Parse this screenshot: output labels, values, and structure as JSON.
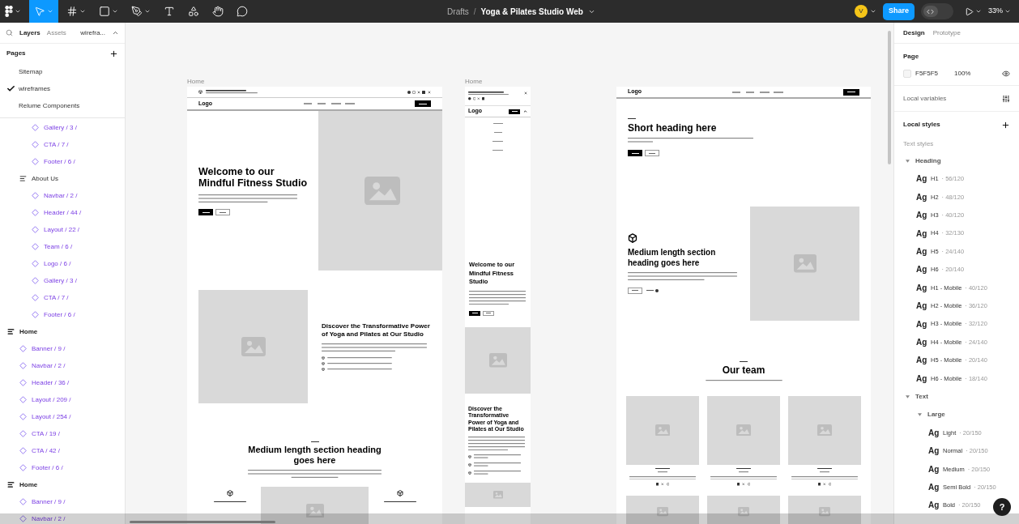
{
  "toolbar": {
    "tools": [
      {
        "kind": "figma",
        "selected": false,
        "menu": true
      },
      {
        "kind": "move",
        "selected": true,
        "menu": true
      },
      {
        "kind": "frame",
        "selected": false,
        "menu": true
      },
      {
        "kind": "shape",
        "selected": false,
        "menu": true
      },
      {
        "kind": "pen",
        "selected": false,
        "menu": true
      },
      {
        "kind": "text",
        "selected": false,
        "menu": false
      },
      {
        "kind": "resources",
        "selected": false,
        "menu": false
      },
      {
        "kind": "hand",
        "selected": false,
        "menu": false
      },
      {
        "kind": "comment",
        "selected": false,
        "menu": false
      }
    ],
    "breadcrumb": {
      "folder": "Drafts",
      "separator": "/",
      "file": "Yoga & Pilates Studio Web"
    },
    "avatar": "V",
    "share": "Share",
    "dev_mode": false,
    "zoom": "33%"
  },
  "left_panel": {
    "tabs": [
      {
        "label": "Layers",
        "selected": true
      },
      {
        "label": "Assets",
        "selected": false
      }
    ],
    "page_switcher": "wirefra...",
    "pages_title": "Pages",
    "pages": [
      {
        "name": "Sitemap",
        "selected": false
      },
      {
        "name": "wireframes",
        "selected": true
      },
      {
        "name": "Relume Components",
        "selected": false
      }
    ],
    "layers": [
      {
        "children": [
          {
            "children": [
              {
                "name": "Gallery / 3 /",
                "kind": "component"
              },
              {
                "name": "CTA / 7 /",
                "kind": "component"
              },
              {
                "name": "Footer / 6 /",
                "kind": "component"
              }
            ]
          },
          {
            "name": "About Us",
            "kind": "frame",
            "children": [
              {
                "name": "Navbar / 2 /",
                "kind": "component"
              },
              {
                "name": "Header / 44 /",
                "kind": "component"
              },
              {
                "name": "Layout / 22 /",
                "kind": "component"
              },
              {
                "name": "Team / 6 /",
                "kind": "component"
              },
              {
                "name": "Logo / 6 /",
                "kind": "component"
              },
              {
                "name": "Gallery / 3 /",
                "kind": "component"
              },
              {
                "name": "CTA / 7 /",
                "kind": "component"
              },
              {
                "name": "Footer / 6 /",
                "kind": "component"
              }
            ]
          }
        ]
      },
      {
        "name": "Home",
        "kind": "frame",
        "children": [
          {
            "name": "Banner / 9 /",
            "kind": "component"
          },
          {
            "name": "Navbar / 2 /",
            "kind": "component"
          },
          {
            "name": "Header / 36 /",
            "kind": "component"
          },
          {
            "name": "Layout / 209 /",
            "kind": "component"
          },
          {
            "name": "Layout / 254 /",
            "kind": "component"
          },
          {
            "name": "CTA / 19 /",
            "kind": "component"
          },
          {
            "name": "CTA / 42 /",
            "kind": "component"
          },
          {
            "name": "Footer / 6 /",
            "kind": "component"
          }
        ]
      },
      {
        "name": "Home",
        "kind": "frame",
        "children": [
          {
            "name": "Banner / 9 /",
            "kind": "component"
          },
          {
            "name": "Navbar / 2 /",
            "kind": "component"
          }
        ]
      }
    ]
  },
  "canvas": {
    "frames": [
      {
        "kind": "desktop-home",
        "label": "Home",
        "navbar": {
          "logo": "Logo"
        },
        "header": {
          "heading": "Welcome to our Mindful Fitness Studio",
          "buttons": [
            {
              "kind": "primary"
            },
            {
              "kind": "secondary"
            }
          ]
        },
        "feature": {
          "heading": "Discover the Transformative Power of Yoga and Pilates at Our Studio"
        },
        "section": {
          "heading": "Medium length section heading goes here"
        }
      },
      {
        "kind": "mobile-home",
        "label": "Home",
        "navbar": {
          "logo": "Logo",
          "menu_expanded": true
        },
        "header": {
          "heading": "Welcome to our Mindful Fitness Studio",
          "buttons": [
            {
              "kind": "primary"
            },
            {
              "kind": "secondary"
            }
          ]
        },
        "feature": {
          "heading": "Discover the Transformative Power of Yoga and Pilates at Our Studio"
        }
      },
      {
        "kind": "desktop-about",
        "navbar": {
          "logo": "Logo"
        },
        "header": {
          "heading": "Short heading here",
          "buttons": [
            {
              "kind": "primary"
            },
            {
              "kind": "secondary"
            }
          ]
        },
        "layout": {
          "heading": "Medium length section heading goes here",
          "buttons": [
            {
              "kind": "secondary"
            },
            {
              "kind": "link"
            }
          ]
        },
        "team": {
          "heading": "Our team"
        }
      }
    ]
  },
  "right_panel": {
    "tabs": [
      {
        "label": "Design",
        "selected": true
      },
      {
        "label": "Prototype",
        "selected": false
      }
    ],
    "page": {
      "title": "Page",
      "color": "F5F5F5",
      "opacity": "100%"
    },
    "local_variables": "Local variables",
    "local_styles": "Local styles",
    "text_styles_title": "Text styles",
    "text_styles": [
      {
        "kind": "group",
        "name": "Heading",
        "expanded": true,
        "children": [
          {
            "kind": "style",
            "preview": "Ag",
            "name": "H1",
            "spec": "· 56/120"
          },
          {
            "kind": "style",
            "preview": "Ag",
            "name": "H2",
            "spec": "· 48/120"
          },
          {
            "kind": "style",
            "preview": "Ag",
            "name": "H3",
            "spec": "· 40/120"
          },
          {
            "kind": "style",
            "preview": "Ag",
            "name": "H4",
            "spec": "· 32/130"
          },
          {
            "kind": "style",
            "preview": "Ag",
            "name": "H5",
            "spec": "· 24/140"
          },
          {
            "kind": "style",
            "preview": "Ag",
            "name": "H6",
            "spec": "· 20/140"
          },
          {
            "kind": "style",
            "preview": "Ag",
            "name": "H1 - Mobile",
            "spec": "· 40/120"
          },
          {
            "kind": "style",
            "preview": "Ag",
            "name": "H2 - Mobile",
            "spec": "· 36/120"
          },
          {
            "kind": "style",
            "preview": "Ag",
            "name": "H3 - Mobile",
            "spec": "· 32/120"
          },
          {
            "kind": "style",
            "preview": "Ag",
            "name": "H4 - Mobile",
            "spec": "· 24/140"
          },
          {
            "kind": "style",
            "preview": "Ag",
            "name": "H5 - Mobile",
            "spec": "· 20/140"
          },
          {
            "kind": "style",
            "preview": "Ag",
            "name": "H6 - Mobile",
            "spec": "· 18/140"
          }
        ]
      },
      {
        "kind": "group",
        "name": "Text",
        "expanded": true,
        "children": [
          {
            "kind": "group",
            "name": "Large",
            "expanded": true,
            "children": [
              {
                "kind": "style",
                "preview": "Ag",
                "name": "Light",
                "spec": "· 20/150"
              },
              {
                "kind": "style",
                "preview": "Ag",
                "name": "Normal",
                "spec": "· 20/150"
              },
              {
                "kind": "style",
                "preview": "Ag",
                "name": "Medium",
                "spec": "· 20/150"
              },
              {
                "kind": "style",
                "preview": "Ag",
                "name": "Semi Bold",
                "spec": "· 20/150"
              },
              {
                "kind": "style",
                "preview": "Ag",
                "name": "Bold",
                "spec": "· 20/150"
              }
            ]
          }
        ]
      }
    ]
  },
  "help": "?"
}
